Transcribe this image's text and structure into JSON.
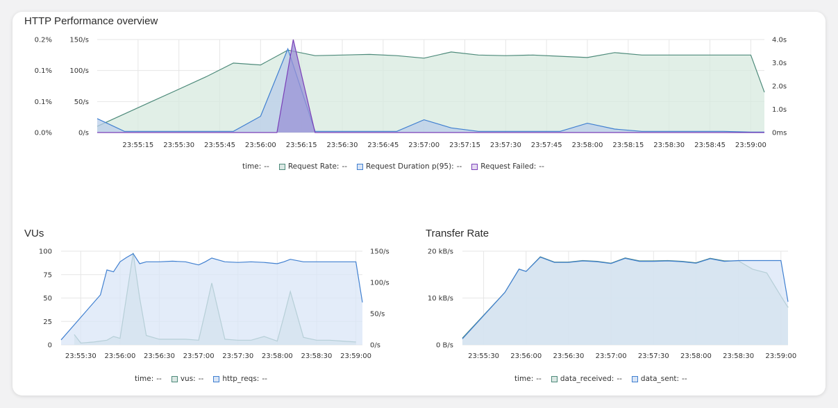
{
  "http": {
    "title": "HTTP Performance overview",
    "legend": {
      "time_label": "time:",
      "time_value": "--",
      "items": [
        {
          "label": "Request Rate:",
          "value": "--",
          "color": "#4d8a7a"
        },
        {
          "label": "Request Duration p(95):",
          "value": "--",
          "color": "#3f7fd0"
        },
        {
          "label": "Request Failed:",
          "value": "--",
          "color": "#7a3fb8"
        }
      ]
    }
  },
  "vus": {
    "title": "VUs",
    "legend": {
      "time_label": "time:",
      "time_value": "--",
      "items": [
        {
          "label": "vus:",
          "value": "--",
          "color": "#4d8a7a"
        },
        {
          "label": "http_reqs:",
          "value": "--",
          "color": "#3f7fd0"
        }
      ]
    }
  },
  "transfer": {
    "title": "Transfer Rate",
    "legend": {
      "time_label": "time:",
      "time_value": "--",
      "items": [
        {
          "label": "data_received:",
          "value": "--",
          "color": "#4d8a7a"
        },
        {
          "label": "data_sent:",
          "value": "--",
          "color": "#3f7fd0"
        }
      ]
    }
  },
  "chart_data": [
    {
      "type": "area",
      "title": "HTTP Performance overview",
      "x_range": [
        "23:55:00",
        "23:59:05"
      ],
      "x_ticks": [
        "23:55:15",
        "23:55:30",
        "23:55:45",
        "23:56:00",
        "23:56:15",
        "23:56:30",
        "23:56:45",
        "23:57:00",
        "23:57:15",
        "23:57:30",
        "23:57:45",
        "23:58:00",
        "23:58:15",
        "23:58:30",
        "23:58:45",
        "23:59:00"
      ],
      "axes": {
        "left_outer": {
          "ticks": [
            "0.0%",
            "0.1%",
            "0.1%",
            "0.2%"
          ],
          "ylim": [
            0,
            0.2
          ]
        },
        "left_inner": {
          "ticks": [
            "0/s",
            "50/s",
            "100/s",
            "150/s"
          ],
          "ylim": [
            0,
            150
          ]
        },
        "right": {
          "ticks": [
            "0ms",
            "1.0s",
            "2.0s",
            "3.0s",
            "4.0s"
          ],
          "ylim": [
            0,
            4
          ]
        }
      },
      "grid": true,
      "series": [
        {
          "name": "Request Rate",
          "axis": "left_inner",
          "color": "#4d8a7a",
          "fill": "#d7eadf",
          "x": [
            "23:55:00",
            "23:55:10",
            "23:55:20",
            "23:55:30",
            "23:55:40",
            "23:55:50",
            "23:56:00",
            "23:56:10",
            "23:56:20",
            "23:56:30",
            "23:56:40",
            "23:56:50",
            "23:57:00",
            "23:57:10",
            "23:57:20",
            "23:57:30",
            "23:57:40",
            "23:57:50",
            "23:58:00",
            "23:58:10",
            "23:58:20",
            "23:58:30",
            "23:58:40",
            "23:58:50",
            "23:59:00",
            "23:59:05"
          ],
          "values": [
            10,
            30,
            50,
            70,
            90,
            112,
            109,
            133,
            124,
            125,
            126,
            124,
            120,
            130,
            125,
            124,
            125,
            123,
            121,
            129,
            125,
            125,
            125,
            125,
            125,
            65
          ]
        },
        {
          "name": "Request Duration p(95)",
          "axis": "right",
          "color": "#3f7fd0",
          "fill": "#b9cdea",
          "x": [
            "23:55:00",
            "23:55:10",
            "23:55:20",
            "23:55:30",
            "23:55:40",
            "23:55:50",
            "23:56:00",
            "23:56:10",
            "23:56:20",
            "23:56:30",
            "23:56:40",
            "23:56:50",
            "23:57:00",
            "23:57:10",
            "23:57:20",
            "23:57:30",
            "23:57:40",
            "23:57:50",
            "23:58:00",
            "23:58:10",
            "23:58:20",
            "23:58:30",
            "23:58:40",
            "23:58:50",
            "23:59:00",
            "23:59:05"
          ],
          "values": [
            0.6,
            0.05,
            0.05,
            0.05,
            0.05,
            0.05,
            0.7,
            3.6,
            0.05,
            0.05,
            0.05,
            0.05,
            0.55,
            0.2,
            0.05,
            0.05,
            0.05,
            0.05,
            0.4,
            0.15,
            0.05,
            0.05,
            0.05,
            0.05,
            0.02,
            0.02
          ]
        },
        {
          "name": "Request Failed",
          "axis": "left_outer",
          "color": "#7a3fb8",
          "fill": "#9a92d6",
          "x": [
            "23:55:00",
            "23:56:00",
            "23:56:06",
            "23:56:12",
            "23:56:20",
            "23:59:05"
          ],
          "values": [
            0,
            0,
            0,
            0.2,
            0,
            0
          ]
        }
      ]
    },
    {
      "type": "area",
      "title": "VUs",
      "x_range": [
        "23:55:15",
        "23:59:05"
      ],
      "x_ticks": [
        "23:55:30",
        "23:56:00",
        "23:56:30",
        "23:57:00",
        "23:57:30",
        "23:58:00",
        "23:58:30",
        "23:59:00"
      ],
      "axes": {
        "left": {
          "ticks": [
            "0",
            "25",
            "50",
            "75",
            "100"
          ],
          "ylim": [
            0,
            100
          ]
        },
        "right": {
          "ticks": [
            "0/s",
            "50/s",
            "100/s",
            "150/s"
          ],
          "ylim": [
            0,
            150
          ]
        }
      },
      "grid": true,
      "series": [
        {
          "name": "vus",
          "axis": "left",
          "color": "#4d8a7a",
          "fill": "#c3d9d4",
          "x": [
            "23:55:25",
            "23:55:30",
            "23:55:40",
            "23:55:50",
            "23:55:55",
            "23:56:00",
            "23:56:05",
            "23:56:10",
            "23:56:15",
            "23:56:20",
            "23:56:30",
            "23:56:40",
            "23:56:50",
            "23:57:00",
            "23:57:05",
            "23:57:10",
            "23:57:20",
            "23:57:30",
            "23:57:40",
            "23:57:50",
            "23:58:00",
            "23:58:05",
            "23:58:10",
            "23:58:20",
            "23:58:30",
            "23:58:40",
            "23:58:50",
            "23:59:00"
          ],
          "values": [
            11,
            2,
            3,
            5,
            9,
            7,
            52,
            98,
            50,
            10,
            6,
            6,
            6,
            5,
            35,
            66,
            6,
            5,
            5,
            9,
            4,
            30,
            57,
            8,
            5,
            5,
            4,
            3
          ]
        },
        {
          "name": "http_reqs",
          "axis": "right",
          "color": "#3f7fd0",
          "fill": "#d9e5f7",
          "x": [
            "23:55:15",
            "23:55:45",
            "23:55:50",
            "23:55:55",
            "23:56:00",
            "23:56:05",
            "23:56:10",
            "23:56:15",
            "23:56:20",
            "23:56:30",
            "23:56:40",
            "23:56:50",
            "23:57:00",
            "23:57:05",
            "23:57:10",
            "23:57:20",
            "23:57:30",
            "23:57:40",
            "23:57:50",
            "23:58:00",
            "23:58:05",
            "23:58:10",
            "23:58:20",
            "23:58:30",
            "23:58:40",
            "23:58:50",
            "23:59:00",
            "23:59:05"
          ],
          "values": [
            8,
            80,
            120,
            117,
            133,
            140,
            146,
            130,
            133,
            133,
            134,
            133,
            128,
            133,
            139,
            133,
            132,
            133,
            132,
            130,
            133,
            137,
            133,
            133,
            133,
            133,
            133,
            68
          ]
        }
      ]
    },
    {
      "type": "area",
      "title": "Transfer Rate",
      "x_range": [
        "23:55:15",
        "23:59:05"
      ],
      "x_ticks": [
        "23:55:30",
        "23:56:00",
        "23:56:30",
        "23:57:00",
        "23:57:30",
        "23:58:00",
        "23:58:30",
        "23:59:00"
      ],
      "axes": {
        "left": {
          "ticks": [
            "0 B/s",
            "10 kB/s",
            "20 kB/s"
          ],
          "ylim": [
            0,
            25
          ]
        }
      },
      "grid": true,
      "series": [
        {
          "name": "data_received",
          "color": "#4d8a7a",
          "fill": "#c3d9d4",
          "x": [
            "23:55:15",
            "23:55:45",
            "23:55:55",
            "23:56:00",
            "23:56:10",
            "23:56:20",
            "23:56:30",
            "23:56:40",
            "23:56:50",
            "23:57:00",
            "23:57:10",
            "23:57:20",
            "23:57:30",
            "23:57:40",
            "23:57:50",
            "23:58:00",
            "23:58:10",
            "23:58:20",
            "23:58:30",
            "23:58:40",
            "23:58:50",
            "23:59:00",
            "23:59:05"
          ],
          "values": [
            1.8,
            14,
            20.2,
            19.6,
            23.5,
            22.1,
            22.1,
            22.5,
            22.3,
            21.8,
            23.2,
            22.4,
            22.4,
            22.5,
            22.3,
            21.9,
            23.1,
            22.4,
            22.4,
            20.2,
            19.2,
            13,
            10
          ]
        },
        {
          "name": "data_sent",
          "color": "#3f7fd0",
          "fill": "#d9e5f7",
          "x": [
            "23:55:15",
            "23:55:45",
            "23:55:55",
            "23:56:00",
            "23:56:10",
            "23:56:20",
            "23:56:30",
            "23:56:40",
            "23:56:50",
            "23:57:00",
            "23:57:10",
            "23:57:20",
            "23:57:30",
            "23:57:40",
            "23:57:50",
            "23:58:00",
            "23:58:10",
            "23:58:20",
            "23:58:30",
            "23:58:40",
            "23:58:50",
            "23:59:00",
            "23:59:05"
          ],
          "values": [
            1.6,
            14,
            20.2,
            19.6,
            23.4,
            22.0,
            22.0,
            22.4,
            22.2,
            21.7,
            23.1,
            22.3,
            22.3,
            22.4,
            22.2,
            21.8,
            23.0,
            22.3,
            22.5,
            22.5,
            22.5,
            22.5,
            11.5
          ]
        }
      ]
    }
  ]
}
